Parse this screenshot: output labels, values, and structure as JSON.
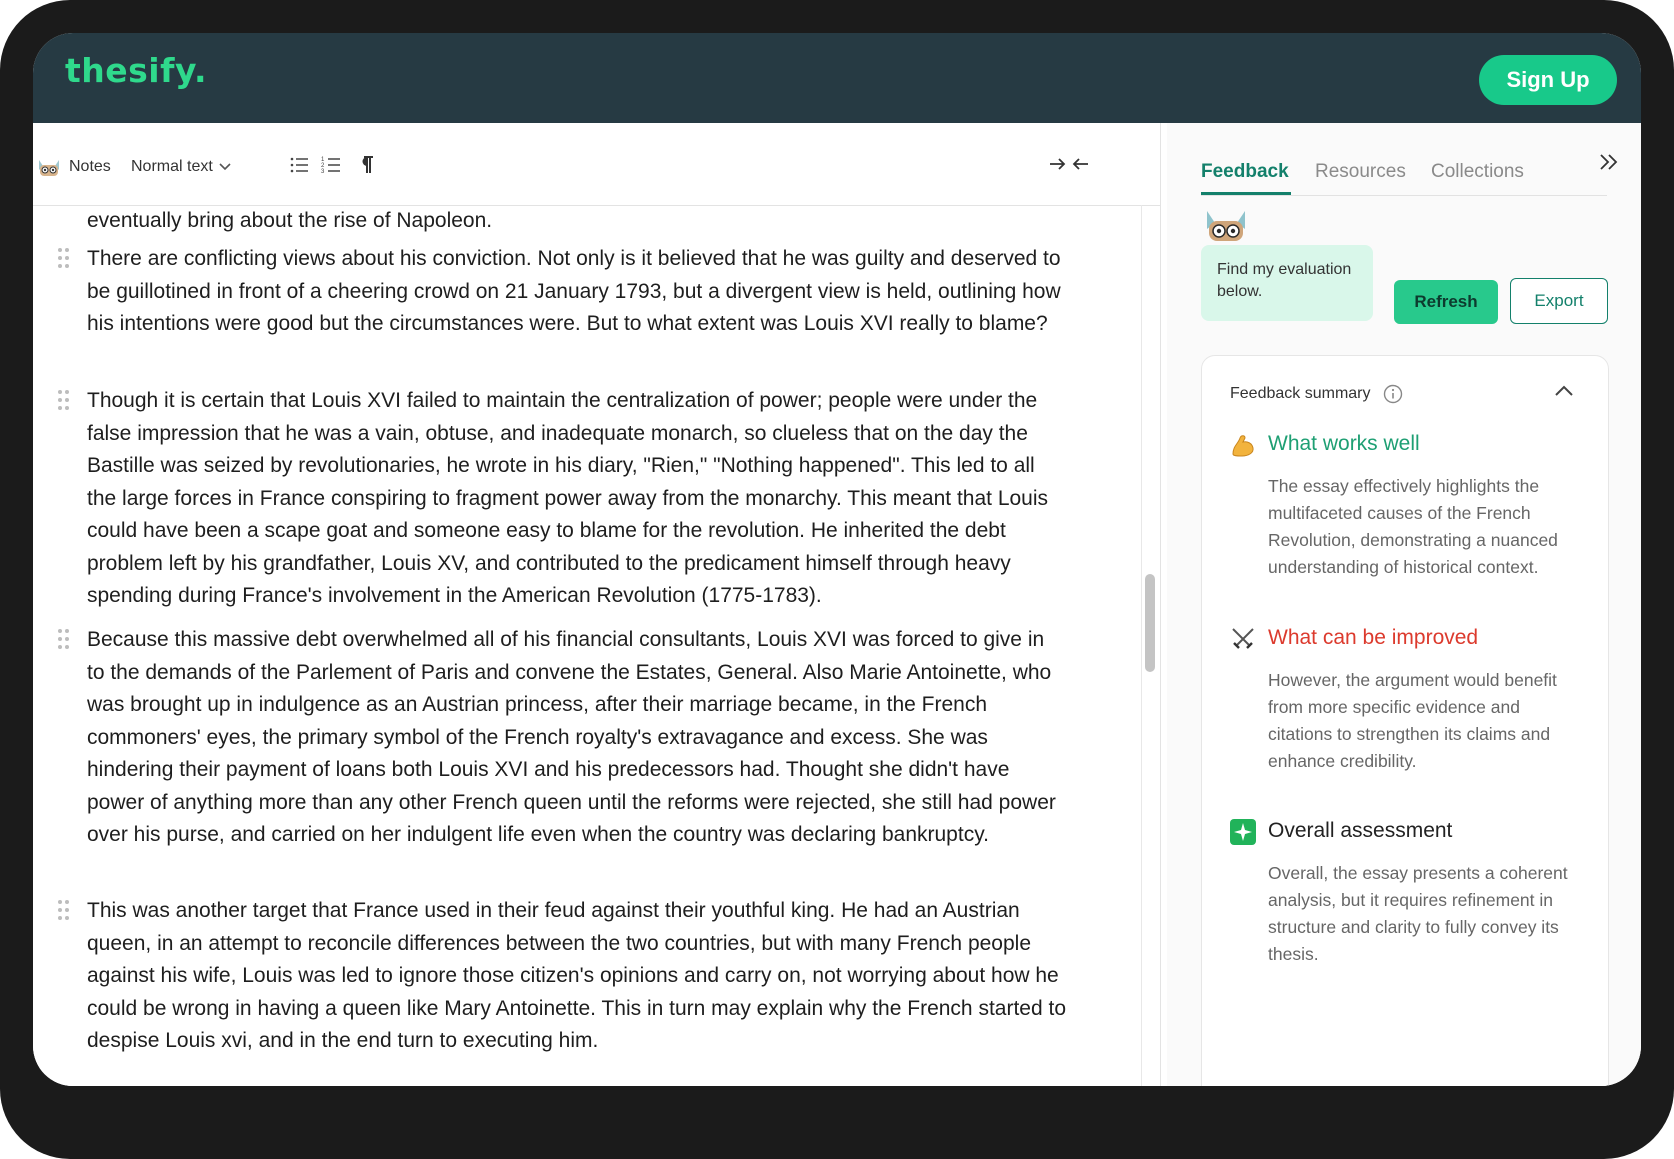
{
  "app": {
    "logo": "thesify.",
    "signup_label": "Sign Up"
  },
  "toolbar": {
    "notes_label": "Notes",
    "text_style": "Normal text"
  },
  "document": {
    "top_fragment": "eventually bring about the rise of Napoleon.",
    "paragraphs": [
      "There are conflicting views about his conviction. Not only is it believed that he was guilty and deserved to be guillotined in front of a cheering crowd on 21 January 1793, but a divergent view is held, outlining how his intentions were good but the circumstances were. But to what extent was Louis XVI really to blame?",
      "Though it is certain that Louis XVI failed to maintain the centralization of power; people were under the false impression that he was a vain, obtuse, and inadequate monarch, so clueless that on the day the Bastille was seized by revolutionaries, he wrote in his diary, \"Rien,\" \"Nothing happened\". This led to all the large forces in France conspiring to fragment power away from the monarchy. This meant that Louis could have been a scape goat and someone easy to blame for the revolution. He inherited the debt problem left by his grandfather, Louis XV, and contributed to the predicament himself through heavy spending during France's involvement in the American Revolution (1775-1783).",
      "Because this massive debt overwhelmed all of his financial consultants, Louis XVI was forced to give in to the demands of the Parlement of Paris and convene the Estates, General. Also Marie Antoinette, who was brought up in indulgence as an Austrian princess, after their marriage became, in the French commoners' eyes, the primary symbol of the French royalty's extravagance and excess. She was hindering their payment of loans both Louis XVI and his predecessors had. Thought she didn't have power of anything more than any other French queen until the reforms were rejected, she still had power over his purse, and carried on her indulgent life even when the country was declaring bankruptcy.",
      "This was another target that France used in their feud against their youthful king. He had an Austrian queen, in an attempt to reconcile differences between the two countries, but with many French people against his wife, Louis was led to ignore those citizen's opinions and carry on, not worrying about how he could be wrong in having a queen like Mary Antoinette. This in turn may explain why the French started to despise Louis xvi, and in the end turn to executing him."
    ]
  },
  "panel": {
    "tabs": [
      "Feedback",
      "Resources",
      "Collections"
    ],
    "active_tab": "Feedback",
    "bubble_text": "Find my evaluation below.",
    "refresh_label": "Refresh",
    "export_label": "Export",
    "summary_title": "Feedback summary",
    "sections": {
      "good": {
        "title": "What works well",
        "body": "The essay effectively highlights the multifaceted causes of the French Revolution, demonstrating a nuanced understanding of historical context."
      },
      "improve": {
        "title": "What can be improved",
        "body": "However, the argument would benefit from more specific evidence and citations to strengthen its claims and enhance credibility."
      },
      "overall": {
        "title": "Overall assessment",
        "body": "Overall, the essay presents a coherent analysis, but it requires refinement in structure and clarity to fully convey its thesis."
      }
    }
  },
  "colors": {
    "brand_green": "#2fd98c",
    "header_bg": "#263a43",
    "accent": "#13806b",
    "good": "#1e9f73",
    "bad": "#dc3a2d"
  },
  "icons": [
    "notes-mascot-icon",
    "chevron-down-icon",
    "bullet-list-icon",
    "numbered-list-icon",
    "paragraph-icon",
    "collapse-icon",
    "expand-panel-icon",
    "mascot-icon",
    "info-icon",
    "chevron-up-icon",
    "flexed-biceps-icon",
    "crossed-swords-icon",
    "sparkle-icon",
    "drag-handle-icon"
  ]
}
